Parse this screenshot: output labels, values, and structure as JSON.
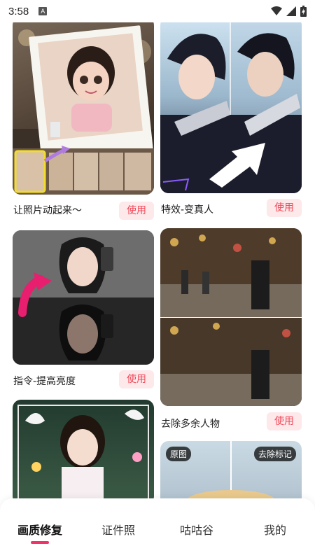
{
  "status_bar": {
    "time": "3:58",
    "notification_letter": "A",
    "icons": [
      "wifi-icon",
      "signal-icon",
      "battery-charging-icon"
    ]
  },
  "cards": [
    {
      "title": "让照片动起来～",
      "button": "使用"
    },
    {
      "title": "特效-变真人",
      "button": "使用"
    },
    {
      "title": "指令-提高亮度",
      "button": "使用"
    },
    {
      "title": "去除多余人物",
      "button": "使用"
    },
    {
      "title": "",
      "button": ""
    },
    {
      "tag_left": "原图",
      "tag_right": "去除标记"
    }
  ],
  "bottom_nav": {
    "items": [
      {
        "label": "画质修复",
        "active": true
      },
      {
        "label": "证件照",
        "active": false
      },
      {
        "label": "咕咕谷",
        "active": false
      },
      {
        "label": "我的",
        "active": false
      }
    ],
    "accent_color": "#f0336a"
  },
  "colors": {
    "button_bg": "#fde8ea",
    "button_text": "#f04a5a"
  }
}
